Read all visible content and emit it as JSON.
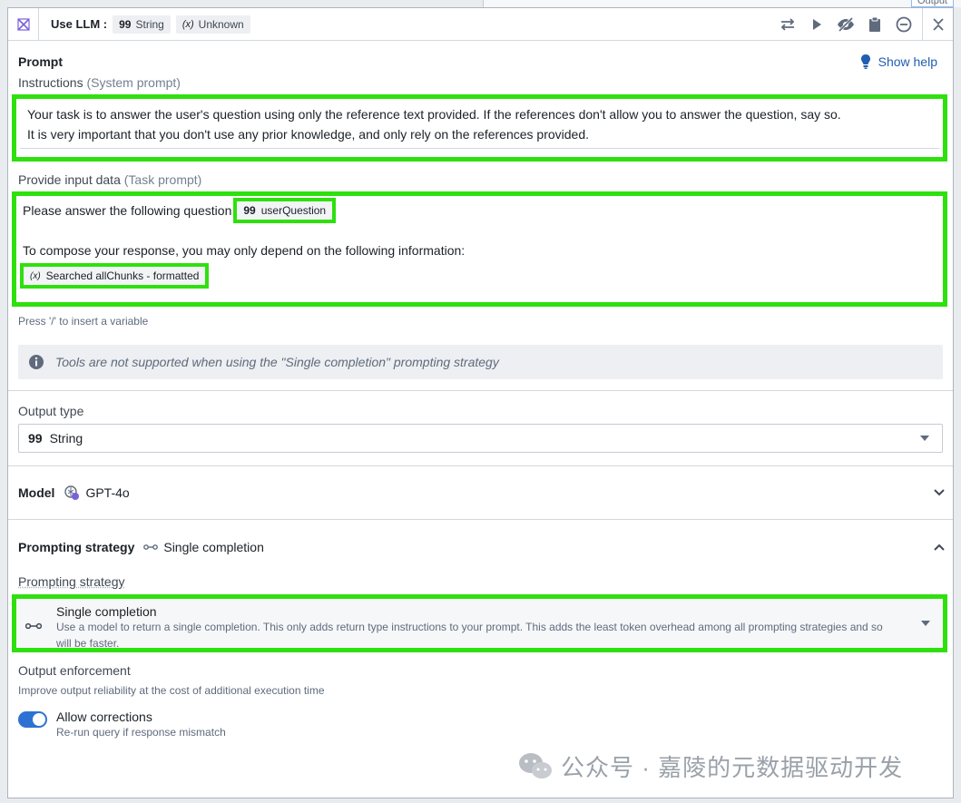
{
  "background_tab": {
    "label": "Output"
  },
  "header": {
    "title": "Use LLM :",
    "chips": [
      {
        "glyph": "99",
        "label": "String"
      },
      {
        "glyph": "(x)",
        "label": "Unknown"
      }
    ],
    "actions": [
      "swap-icon",
      "play-icon",
      "eye-off-icon",
      "clipboard-icon",
      "minus-circle-icon",
      "close-icon"
    ]
  },
  "prompt": {
    "title": "Prompt",
    "help_label": "Show help",
    "instructions_label": "Instructions",
    "instructions_sub": "(System prompt)",
    "instructions_line1": "Your task is to answer the user's question using only the reference text provided. If the references don't allow you to answer the question, say so.",
    "instructions_line2": "It is very important that you don't use any prior knowledge, and only rely on the references provided.",
    "task_label": "Provide input data",
    "task_sub": "(Task prompt)",
    "task_line1": "Please answer the following question",
    "var1_glyph": "99",
    "var1_label": "userQuestion",
    "task_line2": "To compose your response, you may only depend on the following information:",
    "var2_glyph": "(x)",
    "var2_label": "Searched allChunks - formatted",
    "hint": "Press '/' to insert a variable",
    "callout": "Tools are not supported when using the \"Single completion\" prompting strategy"
  },
  "output_type": {
    "label": "Output type",
    "glyph": "99",
    "value": "String"
  },
  "model": {
    "label": "Model",
    "value": "GPT-4o"
  },
  "prompting_strategy": {
    "label": "Prompting strategy",
    "value": "Single completion",
    "field_label": "Prompting strategy",
    "option_title": "Single completion",
    "option_desc_line1": "Use a model to return a single completion. This only adds return type instructions to your prompt. This adds the least token overhead among all prompting strategies and so",
    "option_desc_line2": "will be faster."
  },
  "output_enforcement": {
    "label": "Output enforcement",
    "sub": "Improve output reliability at the cost of additional execution time",
    "toggle_label": "Allow corrections",
    "toggle_sub": "Re-run query if response mismatch",
    "toggle_on": true
  },
  "watermark": "公众号 · 嘉陵的元数据驱动开发",
  "colors": {
    "accent": "#2d72d2",
    "highlight": "#2fe00f",
    "link": "#215db0"
  }
}
